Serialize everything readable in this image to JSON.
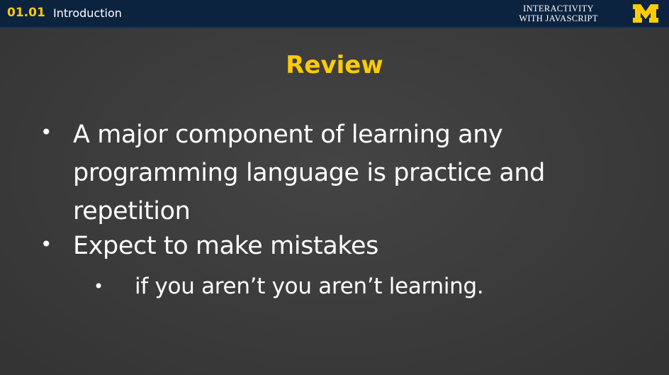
{
  "header": {
    "lesson_number": "01.01",
    "lesson_title": "Introduction",
    "course_line1": "INTERACTIVITY",
    "course_line2": "WITH JAVASCRIPT",
    "logo_letter": "M",
    "logo_icon": "university-block-m-icon"
  },
  "slide": {
    "title": "Review",
    "bullets": [
      {
        "marker": "•",
        "text": "A major component of learning any programming language is practice and repetition"
      },
      {
        "marker": "•",
        "text": "Expect to make mistakes",
        "sub": [
          {
            "marker": "•",
            "text": "if you aren’t you aren’t learning."
          }
        ]
      }
    ]
  },
  "colors": {
    "header_background": "#0c2340",
    "accent_maize": "#ffcb05",
    "slide_background": "#3a3a3a",
    "text": "#ffffff"
  }
}
